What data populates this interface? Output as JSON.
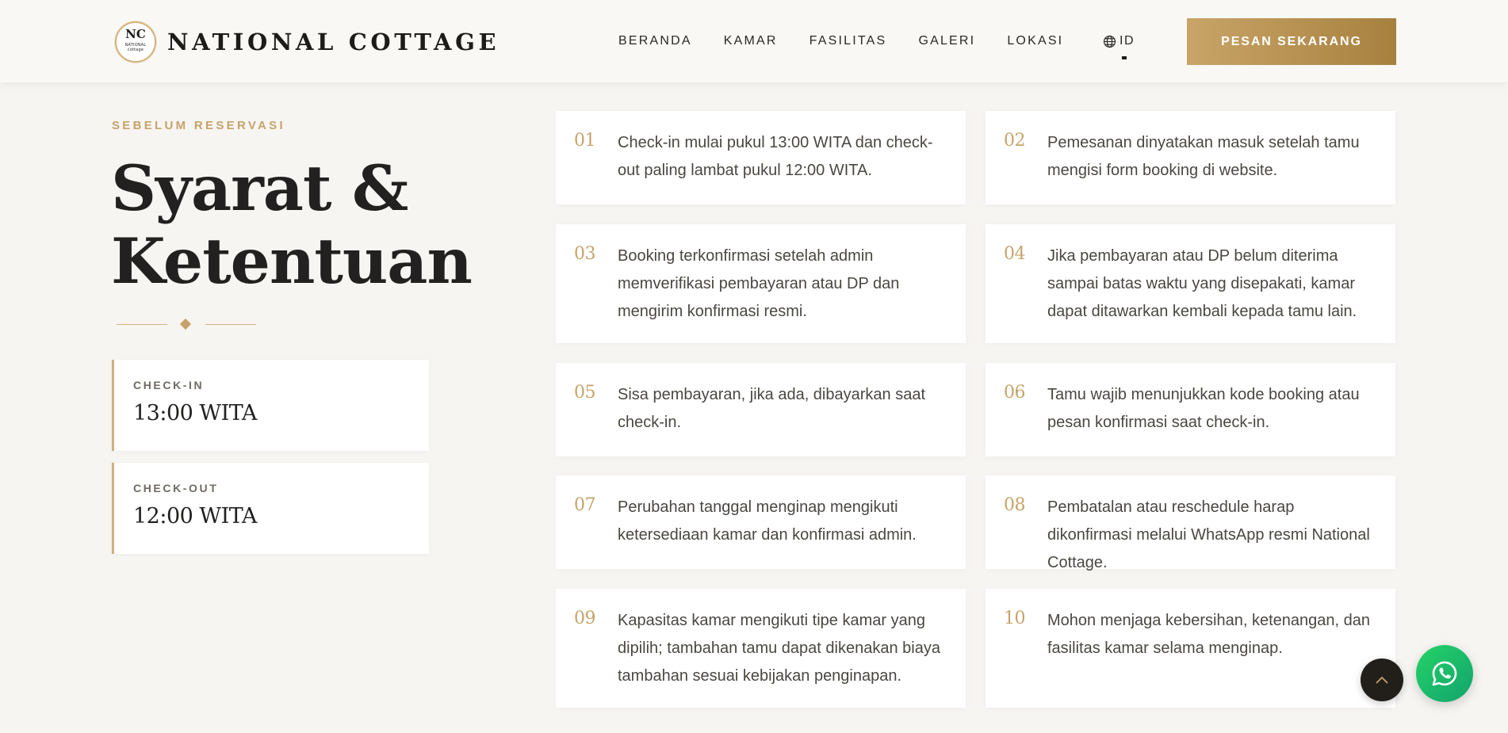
{
  "header": {
    "logo_mark": "NC",
    "logo_small_text": "NATIONAL cottage",
    "brand": "NATIONAL COTTAGE",
    "nav": [
      {
        "label": "BERANDA"
      },
      {
        "label": "KAMAR"
      },
      {
        "label": "FASILITAS"
      },
      {
        "label": "GALERI"
      },
      {
        "label": "LOKASI"
      }
    ],
    "language": "ID",
    "cta_label": "PESAN SEKARANG"
  },
  "intro": {
    "eyebrow": "SEBELUM RESERVASI",
    "title_line1": "Syarat &",
    "title_line2": "Ketentuan"
  },
  "times": [
    {
      "label": "CHECK-IN",
      "value": "13:00 WITA"
    },
    {
      "label": "CHECK-OUT",
      "value": "12:00 WITA"
    }
  ],
  "rules": [
    {
      "number": "01",
      "text": "Check-in mulai pukul 13:00 WITA dan check-out paling lambat pukul 12:00 WITA."
    },
    {
      "number": "02",
      "text": "Pemesanan dinyatakan masuk setelah tamu mengisi form booking di website."
    },
    {
      "number": "03",
      "text": "Booking terkonfirmasi setelah admin memverifikasi pembayaran atau DP dan mengirim konfirmasi resmi."
    },
    {
      "number": "04",
      "text": "Jika pembayaran atau DP belum diterima sampai batas waktu yang disepakati, kamar dapat ditawarkan kembali kepada tamu lain."
    },
    {
      "number": "05",
      "text": "Sisa pembayaran, jika ada, dibayarkan saat check-in."
    },
    {
      "number": "06",
      "text": "Tamu wajib menunjukkan kode booking atau pesan konfirmasi saat check-in."
    },
    {
      "number": "07",
      "text": "Perubahan tanggal menginap mengikuti ketersediaan kamar dan konfirmasi admin."
    },
    {
      "number": "08",
      "text": "Pembatalan atau reschedule harap dikonfirmasi melalui WhatsApp resmi National Cottage."
    },
    {
      "number": "09",
      "text": "Kapasitas kamar mengikuti tipe kamar yang dipilih; tambahan tamu dapat dikenakan biaya tambahan sesuai kebijakan penginapan."
    },
    {
      "number": "10",
      "text": "Mohon menjaga kebersihan, ketenangan, dan fasilitas kamar selama menginap."
    }
  ],
  "icons": {
    "language": "globe-icon",
    "to_top": "chevron-up-icon",
    "whatsapp": "whatsapp-icon"
  },
  "colors": {
    "accent_gold": "#c6a36a",
    "button_gold": "#b8924f",
    "page_background": "#f7f5f1",
    "whatsapp_green": "#25d366"
  }
}
